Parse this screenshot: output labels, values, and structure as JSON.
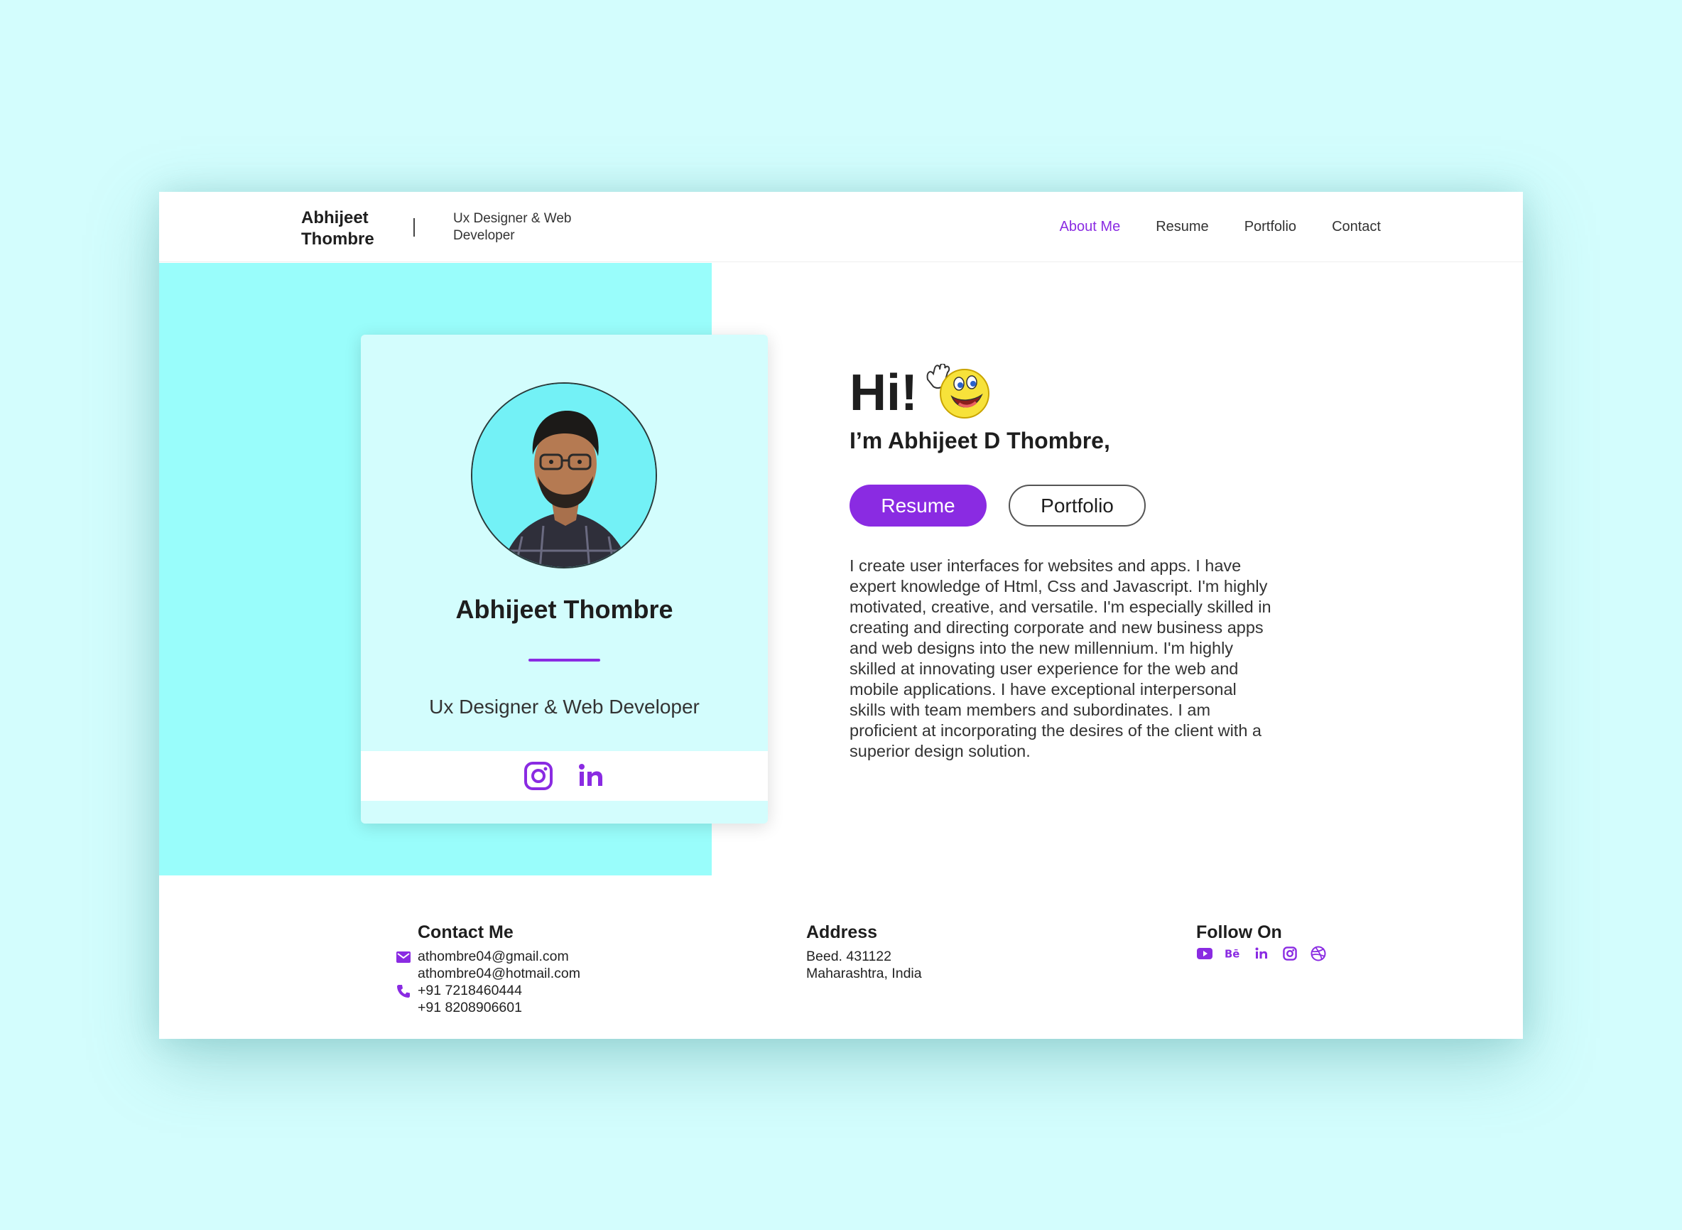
{
  "header": {
    "brand_name": "Abhijeet Thombre",
    "brand_role": "Ux Designer & Web Developer",
    "nav": [
      {
        "label": "About Me",
        "active": true
      },
      {
        "label": "Resume",
        "active": false
      },
      {
        "label": "Portfolio",
        "active": false
      },
      {
        "label": "Contact",
        "active": false
      }
    ]
  },
  "profile_card": {
    "name": "Abhijeet Thombre",
    "role": "Ux Designer & Web Developer",
    "social_icons": [
      "instagram-icon",
      "linkedin-icon"
    ]
  },
  "hero": {
    "greeting": "Hi!",
    "intro": "I’m Abhijeet D Thombre,",
    "resume_label": "Resume",
    "portfolio_label": "Portfolio",
    "bio": "I create user interfaces for websites and apps. I have expert knowledge of Html, Css and Javascript. I'm highly motivated, creative, and versatile. I'm especially skilled in creating and directing corporate and new business apps and web designs into the new millennium. I'm highly skilled at innovating user experience for the web and mobile applications. I have exceptional interpersonal skills with team members and subordinates. I am proficient at incorporating the desires of the client with a superior design solution."
  },
  "footer": {
    "contact": {
      "title": "Contact Me",
      "email_1": "athombre04@gmail.com",
      "email_2": "athombre04@hotmail.com",
      "phone_1": "+91 7218460444",
      "phone_2": "+91 8208906601"
    },
    "address": {
      "title": "Address",
      "line_1": "Beed. 431122",
      "line_2": "Maharashtra, India"
    },
    "follow": {
      "title": "Follow On",
      "icons": [
        "youtube-icon",
        "behance-icon",
        "linkedin-icon",
        "instagram-icon",
        "dribbble-icon"
      ]
    }
  },
  "colors": {
    "accent": "#8a2be2",
    "page_bg": "#d3fdfd",
    "panel_cyan": "#99fdfb",
    "card_bg": "#d3fdfd"
  }
}
